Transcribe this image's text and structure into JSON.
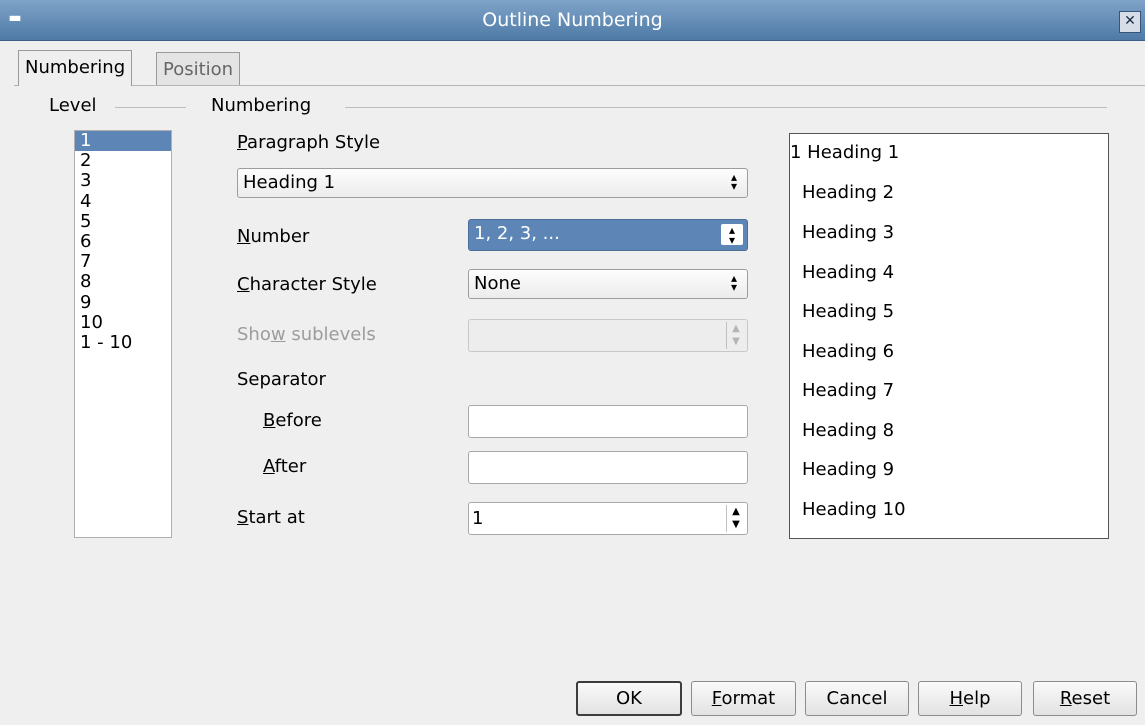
{
  "window": {
    "title": "Outline Numbering"
  },
  "tabs": [
    {
      "label": "Numbering"
    },
    {
      "label": "Position"
    }
  ],
  "level": {
    "group_label": "Level",
    "items": [
      "1",
      "2",
      "3",
      "4",
      "5",
      "6",
      "7",
      "8",
      "9",
      "10",
      "1 - 10"
    ],
    "selected": "1"
  },
  "numbering": {
    "group_label": "Numbering",
    "paragraph_style": {
      "label": "Paragraph Style",
      "mnemonic": "P",
      "rest": "aragraph Style",
      "value": "Heading 1"
    },
    "number": {
      "label": "Number",
      "mnemonic": "N",
      "rest": "umber",
      "value": "1, 2, 3, ..."
    },
    "character_style": {
      "label": "Character Style",
      "mnemonic": "C",
      "rest": "haracter Style",
      "value": "None"
    },
    "show_sublevels": {
      "pre": "Sho",
      "mnemonic": "w",
      "rest": " sublevels",
      "value": ""
    },
    "separator": {
      "label": "Separator",
      "before": {
        "mnemonic": "B",
        "rest": "efore",
        "value": ""
      },
      "after": {
        "mnemonic": "A",
        "rest": "fter",
        "value": ""
      }
    },
    "start_at": {
      "mnemonic": "S",
      "rest": "tart at",
      "value": "1"
    }
  },
  "preview": {
    "items": [
      "1 Heading 1",
      "Heading 2",
      "Heading 3",
      "Heading 4",
      "Heading 5",
      "Heading 6",
      "Heading 7",
      "Heading 8",
      "Heading 9",
      "Heading 10"
    ]
  },
  "buttons": {
    "ok": "OK",
    "format": {
      "mnemonic": "F",
      "rest": "ormat"
    },
    "cancel": "Cancel",
    "help": {
      "mnemonic": "H",
      "rest": "elp"
    },
    "reset": {
      "mnemonic": "R",
      "rest": "eset"
    }
  },
  "colors": {
    "titlebar": "#5d86b7",
    "selection": "#5d86b7"
  }
}
